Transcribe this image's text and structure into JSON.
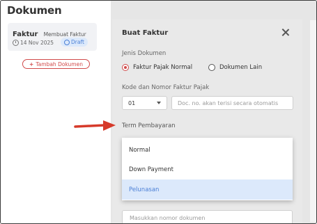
{
  "page": {
    "title": "Dokumen"
  },
  "document_card": {
    "type": "Faktur",
    "subtitle": "Membuat Faktur",
    "date": "14 Nov 2025",
    "status": "Draft"
  },
  "add_button": {
    "label": "Tambah Dokumen"
  },
  "modal": {
    "title": "Buat Faktur",
    "jenis_label": "Jenis Dokumen",
    "radios": [
      {
        "label": "Faktur Pajak Normal",
        "selected": true
      },
      {
        "label": "Dokumen Lain",
        "selected": false
      }
    ],
    "kode_label": "Kode dan Nomor Faktur Pajak",
    "kode_value": "01",
    "nomor_placeholder": "Doc. no. akan terisi secara otomatis",
    "term_label": "Term Pembayaran",
    "term_options": [
      {
        "label": "Normal",
        "selected": false
      },
      {
        "label": "Down Payment",
        "selected": false
      },
      {
        "label": "Pelunasan",
        "selected": true
      }
    ],
    "nomor_dokumen_placeholder": "Masukkan nomor dokumen"
  },
  "colors": {
    "accent": "#d14a4a",
    "selected_bg": "#dce9fb",
    "selected_text": "#4a7fd6"
  }
}
